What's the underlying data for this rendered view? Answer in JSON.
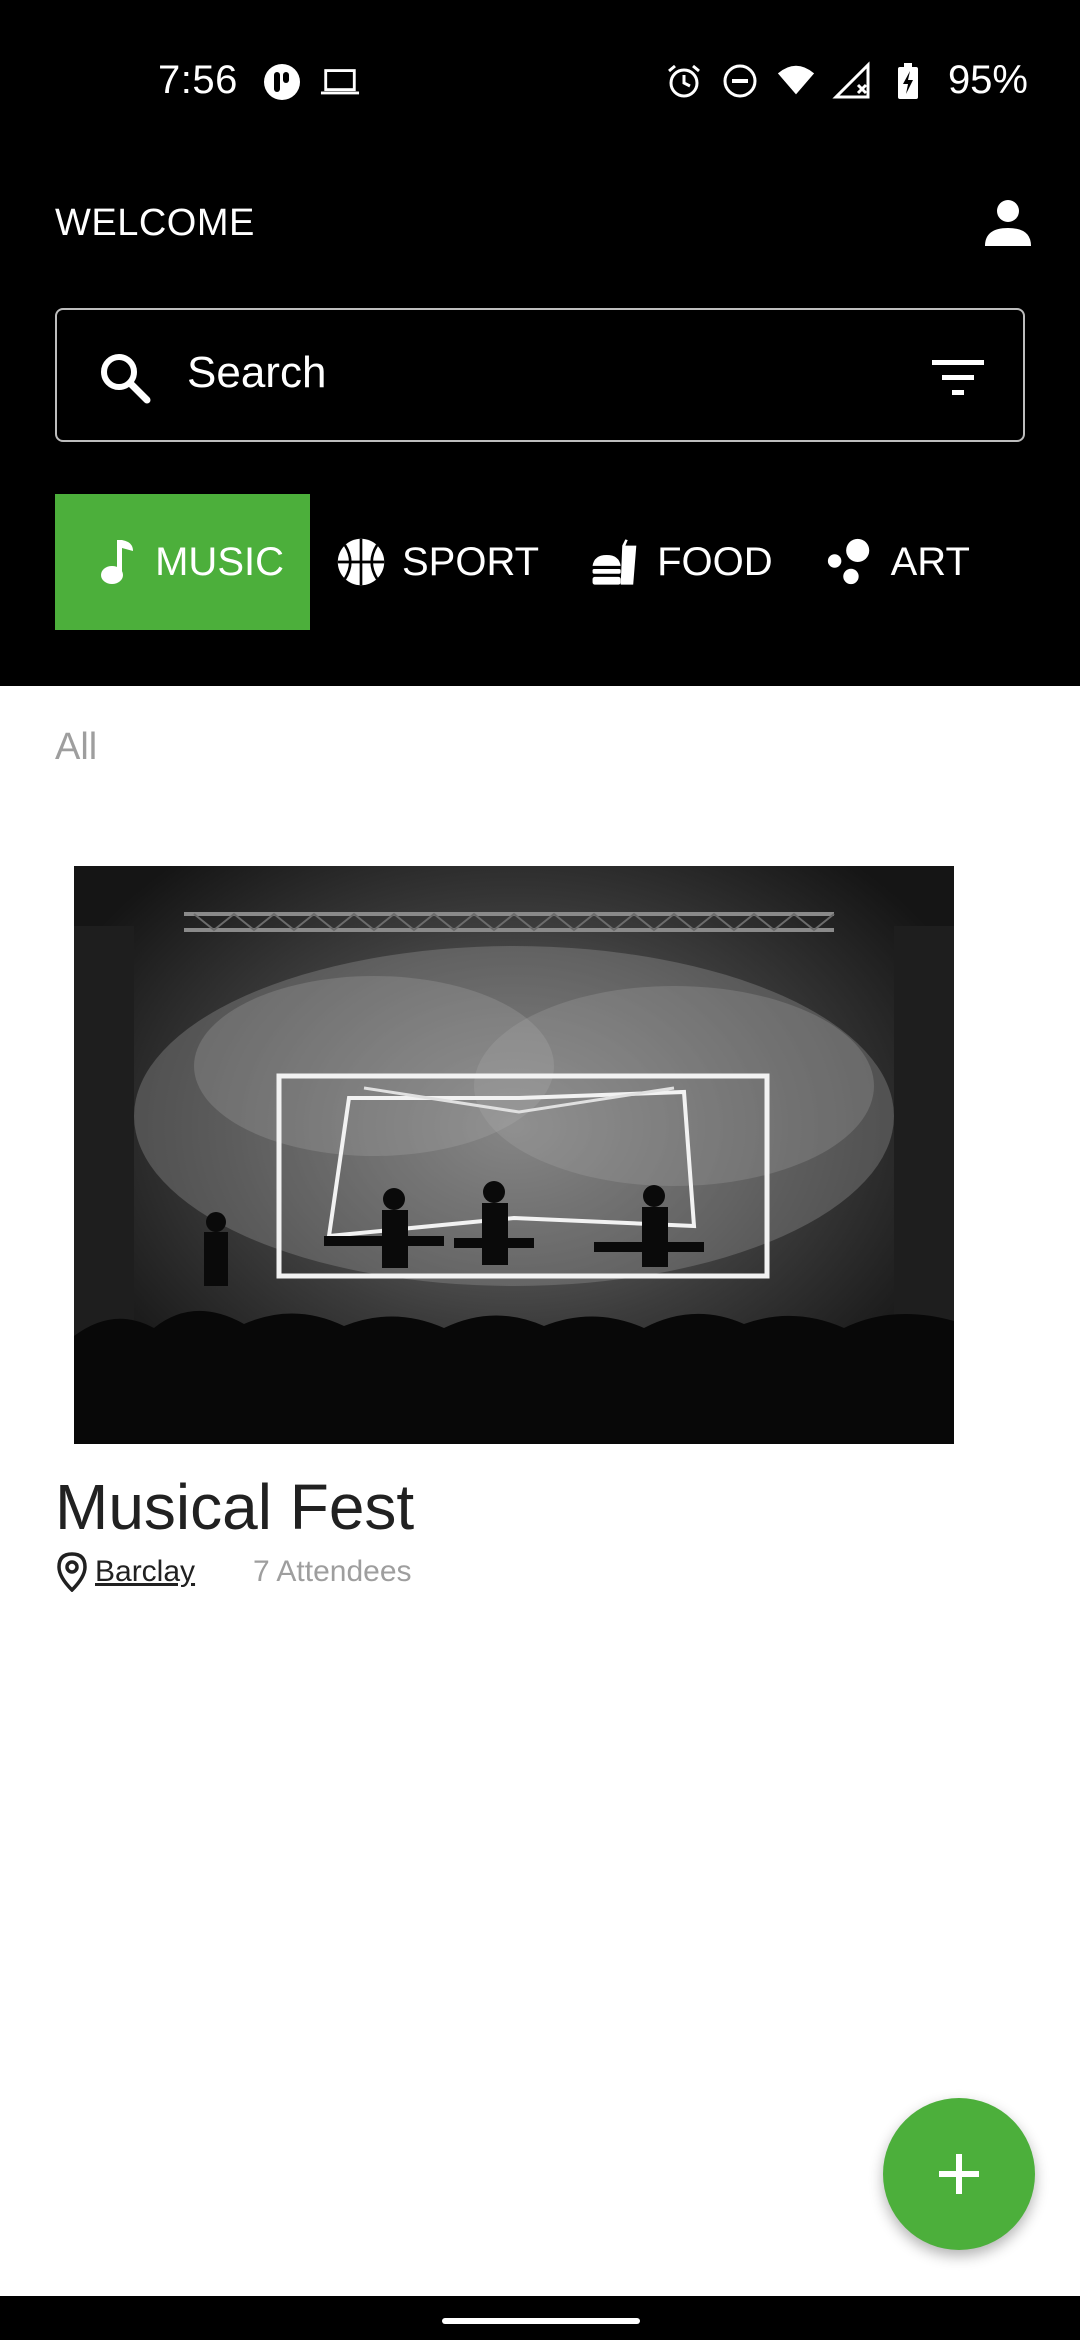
{
  "status_bar": {
    "time": "7:56",
    "battery_percent": "95%",
    "left_icons": [
      "podcast-app-icon",
      "laptop-icon"
    ],
    "right_icons": [
      "alarm-icon",
      "do-not-disturb-icon",
      "wifi-icon",
      "cell-signal-icon",
      "battery-charging-icon"
    ]
  },
  "header": {
    "welcome": "WELCOME",
    "profile_icon": "person-icon"
  },
  "search": {
    "placeholder": "Search",
    "search_icon": "search-icon",
    "filter_icon": "filter-icon"
  },
  "categories": [
    {
      "label": "MUSIC",
      "icon": "music-note-icon",
      "active": true
    },
    {
      "label": "SPORT",
      "icon": "basketball-icon",
      "active": false
    },
    {
      "label": "FOOD",
      "icon": "fast-food-icon",
      "active": false
    },
    {
      "label": "ART",
      "icon": "bubbles-icon",
      "active": false
    }
  ],
  "section": {
    "label": "All"
  },
  "events": [
    {
      "title": "Musical Fest",
      "location": "Barclay",
      "attendees": "7 Attendees",
      "image": "concert-stage-photo"
    }
  ],
  "fab": {
    "icon": "plus-icon"
  },
  "colors": {
    "header_bg": "#000000",
    "accent_green": "#4caf3b",
    "muted_text": "#9e9e9e",
    "title_text": "#212121"
  }
}
